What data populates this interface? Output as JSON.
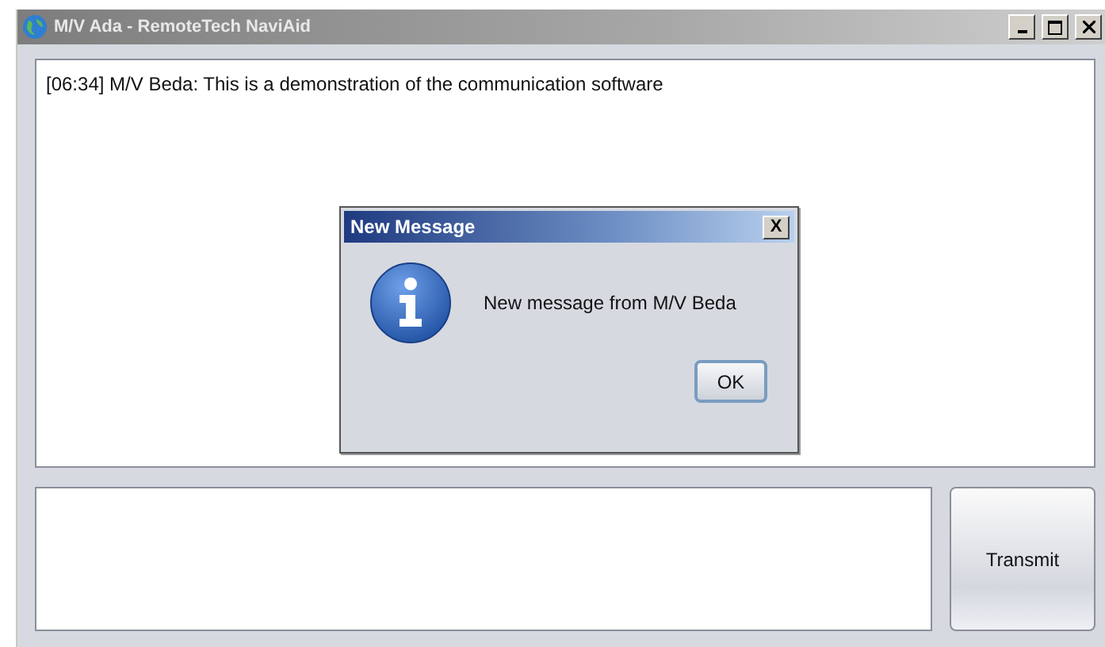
{
  "window": {
    "title": "M/V Ada - RemoteTech NaviAid"
  },
  "chat_log": {
    "lines": [
      "[06:34] M/V Beda: This is a demonstration of the communication software"
    ]
  },
  "dialog": {
    "title": "New Message",
    "close_label": "X",
    "message": "New message from M/V Beda",
    "kind": "info",
    "buttons": [
      "OK"
    ]
  },
  "transmit_button": {
    "label": "Transmit"
  }
}
